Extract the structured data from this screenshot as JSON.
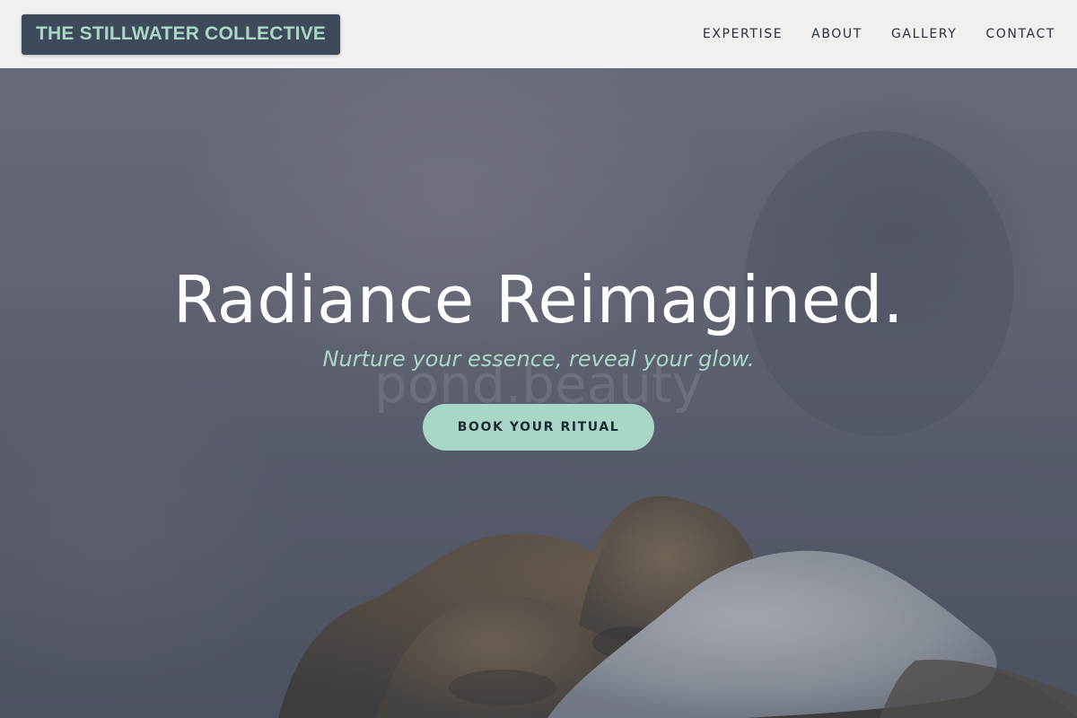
{
  "brand": {
    "name": "THE STILLWATER COLLECTIVE"
  },
  "nav": {
    "items": [
      {
        "label": "EXPERTISE"
      },
      {
        "label": "ABOUT"
      },
      {
        "label": "GALLERY"
      },
      {
        "label": "CONTACT"
      }
    ]
  },
  "hero": {
    "headline": "Radiance Reimagined.",
    "tagline": "Nurture your essence, reveal your glow.",
    "watermark": "pond.beauty",
    "cta_label": "BOOK YOUR RITUAL"
  },
  "colors": {
    "accent": "#a8d8c5",
    "logo_bg": "#3e4a5c",
    "nav_bg": "#f0f0f1",
    "cta_text": "#1f2b35"
  }
}
